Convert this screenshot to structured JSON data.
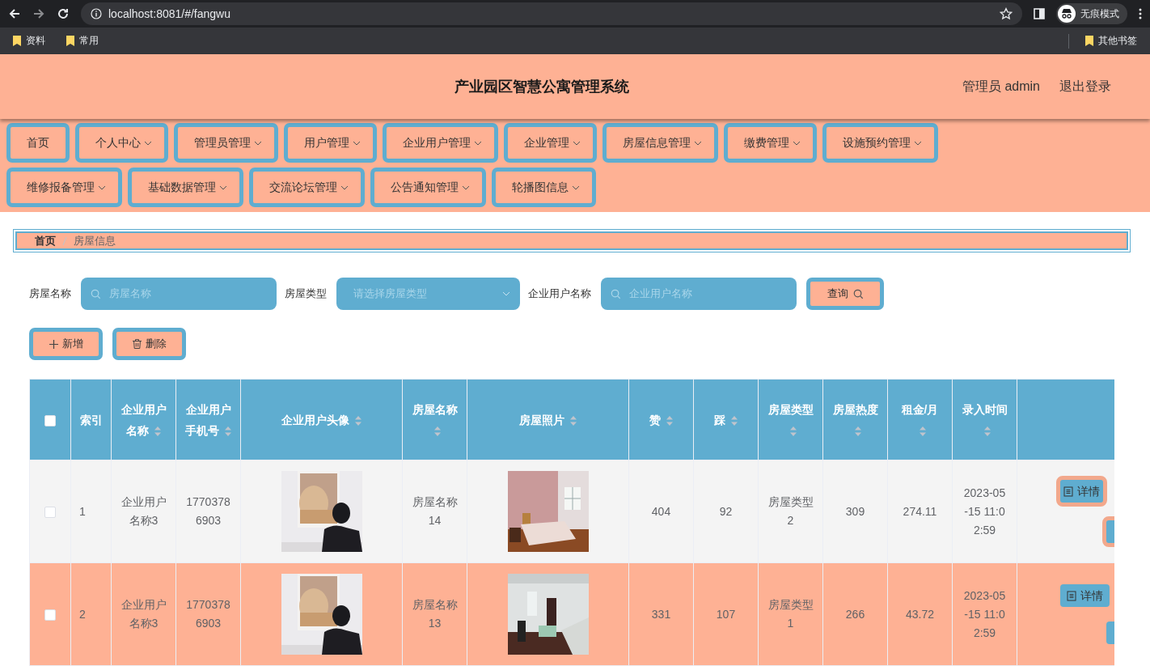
{
  "browser": {
    "url": "localhost:8081/#/fangwu",
    "profile": "无痕模式",
    "bookmarks": [
      "资料",
      "常用"
    ],
    "other_bookmarks": "其他书签"
  },
  "header": {
    "title": "产业园区智慧公寓管理系统",
    "user": "管理员 admin",
    "logout": "退出登录"
  },
  "nav": [
    {
      "label": "首页",
      "has_menu": false
    },
    {
      "label": "个人中心",
      "has_menu": true
    },
    {
      "label": "管理员管理",
      "has_menu": true
    },
    {
      "label": "用户管理",
      "has_menu": true
    },
    {
      "label": "企业用户管理",
      "has_menu": true
    },
    {
      "label": "企业管理",
      "has_menu": true
    },
    {
      "label": "房屋信息管理",
      "has_menu": true
    },
    {
      "label": "缴费管理",
      "has_menu": true
    },
    {
      "label": "设施预约管理",
      "has_menu": true
    },
    {
      "label": "维修报备管理",
      "has_menu": true
    },
    {
      "label": "基础数据管理",
      "has_menu": true
    },
    {
      "label": "交流论坛管理",
      "has_menu": true
    },
    {
      "label": "公告通知管理",
      "has_menu": true
    },
    {
      "label": "轮播图信息",
      "has_menu": true
    }
  ],
  "breadcrumb": [
    {
      "label": "首页",
      "current": false
    },
    {
      "label": "房屋信息",
      "current": true
    }
  ],
  "filters": [
    {
      "label": "房屋名称",
      "kind": "text",
      "placeholder": "房屋名称"
    },
    {
      "label": "房屋类型",
      "kind": "select",
      "placeholder": "请选择房屋类型"
    },
    {
      "label": "企业用户名称",
      "kind": "text",
      "placeholder": "企业用户名称"
    }
  ],
  "search_button": "查询",
  "actions": [
    {
      "kind": "add",
      "label": "新增"
    },
    {
      "kind": "delete",
      "label": "删除"
    }
  ],
  "table": {
    "select_all": {
      "checked": false
    },
    "columns": [
      {
        "label": "索引",
        "sortable": false
      },
      {
        "label": "企业用户名称",
        "sortable": true
      },
      {
        "label": "企业用户手机号",
        "sortable": true
      },
      {
        "label": "企业用户头像",
        "sortable": true
      },
      {
        "label": "房屋名称",
        "sortable": true
      },
      {
        "label": "房屋照片",
        "sortable": true
      },
      {
        "label": "赞",
        "sortable": true
      },
      {
        "label": "踩",
        "sortable": true
      },
      {
        "label": "房屋类型",
        "sortable": true
      },
      {
        "label": "房屋热度",
        "sortable": true
      },
      {
        "label": "租金/月",
        "sortable": true
      },
      {
        "label": "录入时间",
        "sortable": true
      }
    ],
    "rows": [
      {
        "checked": false,
        "highlighted": true,
        "detail_button": "详情",
        "cells": [
          {
            "kind": "text",
            "text": "1"
          },
          {
            "kind": "text",
            "text": "企业用户名称3"
          },
          {
            "kind": "text",
            "text": "17703786903"
          },
          {
            "kind": "picture"
          },
          {
            "kind": "text",
            "text": "房屋名称14"
          },
          {
            "kind": "picture"
          },
          {
            "kind": "text",
            "text": "404"
          },
          {
            "kind": "text",
            "text": "92"
          },
          {
            "kind": "text",
            "text": "房屋类型2"
          },
          {
            "kind": "text",
            "text": "309"
          },
          {
            "kind": "text",
            "text": "274.11"
          },
          {
            "kind": "text",
            "text": "2023-05-15 11:02:59"
          }
        ]
      },
      {
        "checked": false,
        "highlighted": false,
        "detail_button": "详情",
        "cells": [
          {
            "kind": "text",
            "text": "2"
          },
          {
            "kind": "text",
            "text": "企业用户名称3"
          },
          {
            "kind": "text",
            "text": "17703786903"
          },
          {
            "kind": "picture"
          },
          {
            "kind": "text",
            "text": "房屋名称13"
          },
          {
            "kind": "picture"
          },
          {
            "kind": "text",
            "text": "331"
          },
          {
            "kind": "text",
            "text": "107"
          },
          {
            "kind": "text",
            "text": "房屋类型1"
          },
          {
            "kind": "text",
            "text": "266"
          },
          {
            "kind": "text",
            "text": "43.72"
          },
          {
            "kind": "text",
            "text": "2023-05-15 11:02:59"
          }
        ]
      }
    ]
  }
}
